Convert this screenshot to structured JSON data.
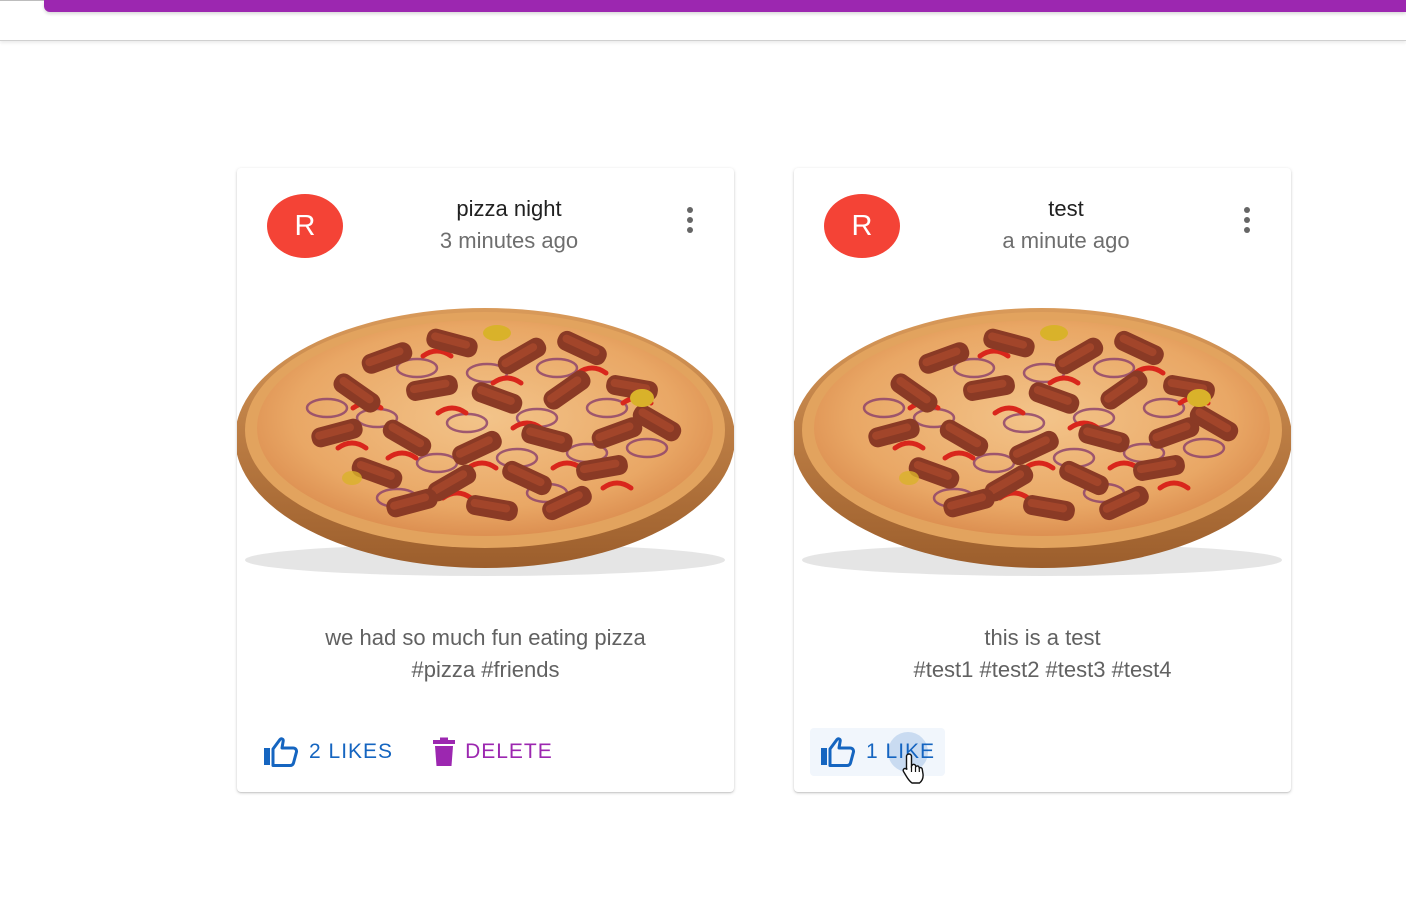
{
  "theme": {
    "accent": "#9c27b0",
    "avatar_color": "#f44336",
    "like_color": "#1565c0",
    "delete_color": "#9c27b0"
  },
  "posts": [
    {
      "avatar_letter": "R",
      "title": "pizza night",
      "subtitle": "3 minutes ago",
      "message": "we had so much fun eating pizza",
      "tags": "#pizza #friends",
      "like_label": "2 LIKES",
      "delete_label": "DELETE",
      "image": "pizza-image"
    },
    {
      "avatar_letter": "R",
      "title": "test",
      "subtitle": "a minute ago",
      "message": "this is a test",
      "tags": "#test1 #test2 #test3 #test4",
      "like_label": "1 LIKE",
      "image": "pizza-image"
    }
  ],
  "icons": {
    "more": "more-vert-icon",
    "like": "thumb-up-icon",
    "delete": "trash-icon",
    "cursor": "hand-pointer-icon"
  }
}
